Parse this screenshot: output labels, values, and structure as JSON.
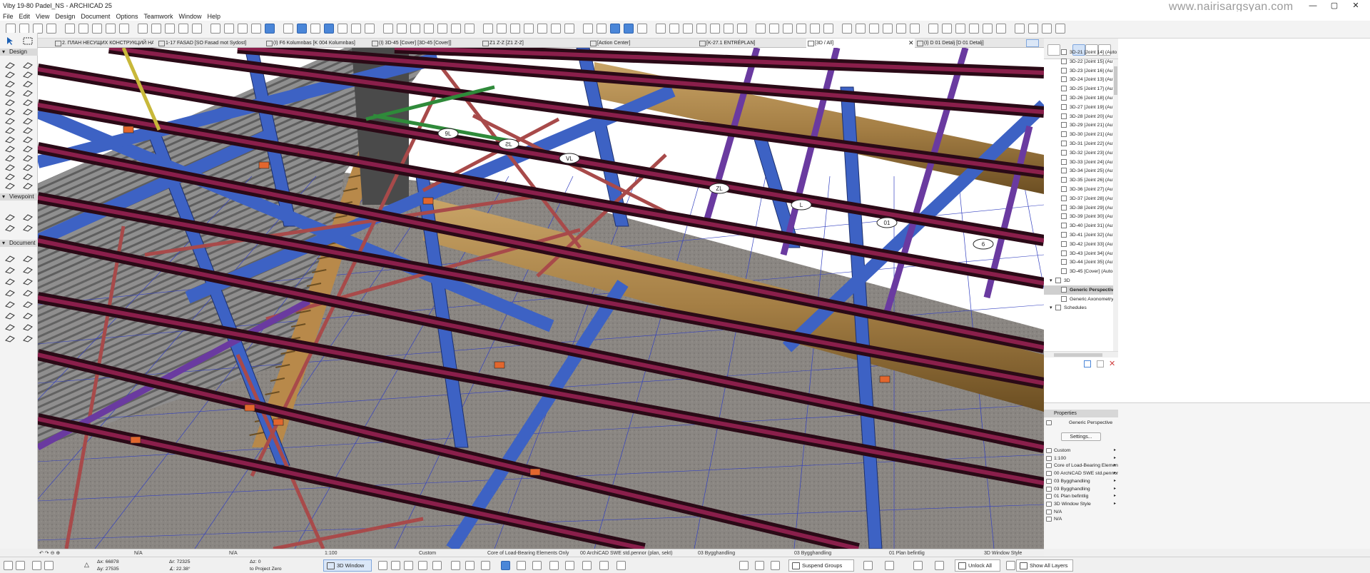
{
  "window": {
    "title": "Viby 19-80 Padel_NS - ARCHICAD 25",
    "watermark": "www.nairisargsyan.com",
    "controls": [
      "—",
      "▢",
      "✕"
    ]
  },
  "menu": [
    "File",
    "Edit",
    "View",
    "Design",
    "Document",
    "Options",
    "Teamwork",
    "Window",
    "Help"
  ],
  "tabs": [
    {
      "label": "2. ПЛАН НЕСУЩИХ КОНСТРУКЦИЙ НА ОТМ...",
      "active": false
    },
    {
      "label": "1-17 FASAD [SO Fasad mot Sydost]",
      "active": false
    },
    {
      "label": "(I) F6 Kolumnbas [K 004 Kolumnbas]",
      "active": false
    },
    {
      "label": "(I) 3D-45 [Cover] [3D-45 [Cover]]",
      "active": false
    },
    {
      "label": "Z1 Z-Z [Z1 Z-Z]",
      "active": false
    },
    {
      "label": "[Action Center]",
      "active": false
    },
    {
      "label": "[K-27.1 ENTRÉPLAN]",
      "active": false
    },
    {
      "label": "[3D / All]",
      "active": true
    },
    {
      "label": "(I) D 01 Detalj [D 01 Detalj]",
      "active": false
    }
  ],
  "toolbox": {
    "sections": [
      "Design",
      "Viewpoint",
      "Document"
    ]
  },
  "navigator": {
    "items": [
      {
        "label": "3D-21 [Joint 14] (Auto",
        "indent": 1
      },
      {
        "label": "3D-22 [Joint 15] (Auto",
        "indent": 1
      },
      {
        "label": "3D-23 [Joint 16] (Auto",
        "indent": 1
      },
      {
        "label": "3D-24 [Joint 13] (Auto",
        "indent": 1
      },
      {
        "label": "3D-25 [Joint 17] (Auto",
        "indent": 1
      },
      {
        "label": "3D-26 [Joint 18] (Auto",
        "indent": 1
      },
      {
        "label": "3D-27 [Joint 19] (Auto",
        "indent": 1
      },
      {
        "label": "3D-28 [Joint 20] (Auto",
        "indent": 1
      },
      {
        "label": "3D-29 [Joint 21] (Auto",
        "indent": 1
      },
      {
        "label": "3D-30 [Joint 21] (Auto",
        "indent": 1
      },
      {
        "label": "3D-31 [Joint 22] (Auto",
        "indent": 1
      },
      {
        "label": "3D-32 [Joint 23] (Auto",
        "indent": 1
      },
      {
        "label": "3D-33 [Joint 24] (Auto",
        "indent": 1
      },
      {
        "label": "3D-34 [Joint 25] (Auto",
        "indent": 1
      },
      {
        "label": "3D-35 [Joint 26] (Auto",
        "indent": 1
      },
      {
        "label": "3D-36 [Joint 27] (Auto",
        "indent": 1
      },
      {
        "label": "3D-37 [Joint 28] (Auto",
        "indent": 1
      },
      {
        "label": "3D-38 [Joint 29] (Auto",
        "indent": 1
      },
      {
        "label": "3D-39 [Joint 30] (Auto",
        "indent": 1
      },
      {
        "label": "3D-40 [Joint 31] (Auto",
        "indent": 1
      },
      {
        "label": "3D-41 [Joint 32] (Auto",
        "indent": 1
      },
      {
        "label": "3D-42 [Joint 33] (Auto",
        "indent": 1
      },
      {
        "label": "3D-43 [Joint 34] (Auto",
        "indent": 1
      },
      {
        "label": "3D-44 [Joint 35] (Auto",
        "indent": 1
      },
      {
        "label": "3D-45 [Cover] (Auto-r",
        "indent": 1
      },
      {
        "label": "3D",
        "indent": 0
      },
      {
        "label": "Generic Perspective",
        "indent": 1,
        "selected": true
      },
      {
        "label": "Generic Axonometry",
        "indent": 1
      },
      {
        "label": "Schedules",
        "indent": 0
      }
    ]
  },
  "properties": {
    "header": "Properties",
    "view_name": "Generic Perspective",
    "settings_label": "Settings...",
    "rows": [
      "Custom",
      "1:100",
      "Core of Load-Bearing Element...",
      "00 ArchiCAD SWE std.pennor (...",
      "03 Bygghandling",
      "03 Bygghandling",
      "01 Plan befintlig",
      "3D Window Style",
      "N/A",
      "N/A"
    ]
  },
  "statusbar": {
    "items": [
      "N/A",
      "N/A",
      "1:100",
      "Custom",
      "Core of Load-Bearing Elements Only",
      "00 ArchiCAD SWE std.pennor (plan, sekt)",
      "03 Bygghandling",
      "03 Bygghandling",
      "01 Plan befintlig",
      "3D Window Style"
    ]
  },
  "bottombar": {
    "coords": {
      "dx": "66878",
      "dy": "27535",
      "ddx": "72325",
      "dda": "22.38°",
      "dz": "0",
      "ref": "to Project Zero"
    },
    "view_button": "3D Window",
    "suspend_groups": "Suspend Groups",
    "unlock_all": "Unlock All",
    "show_all_layers": "Show All Layers"
  },
  "viewport": {
    "grid_labels": [
      "6",
      "01",
      "L",
      "ZL",
      "ᐯL",
      "ƧL",
      "9L"
    ]
  }
}
